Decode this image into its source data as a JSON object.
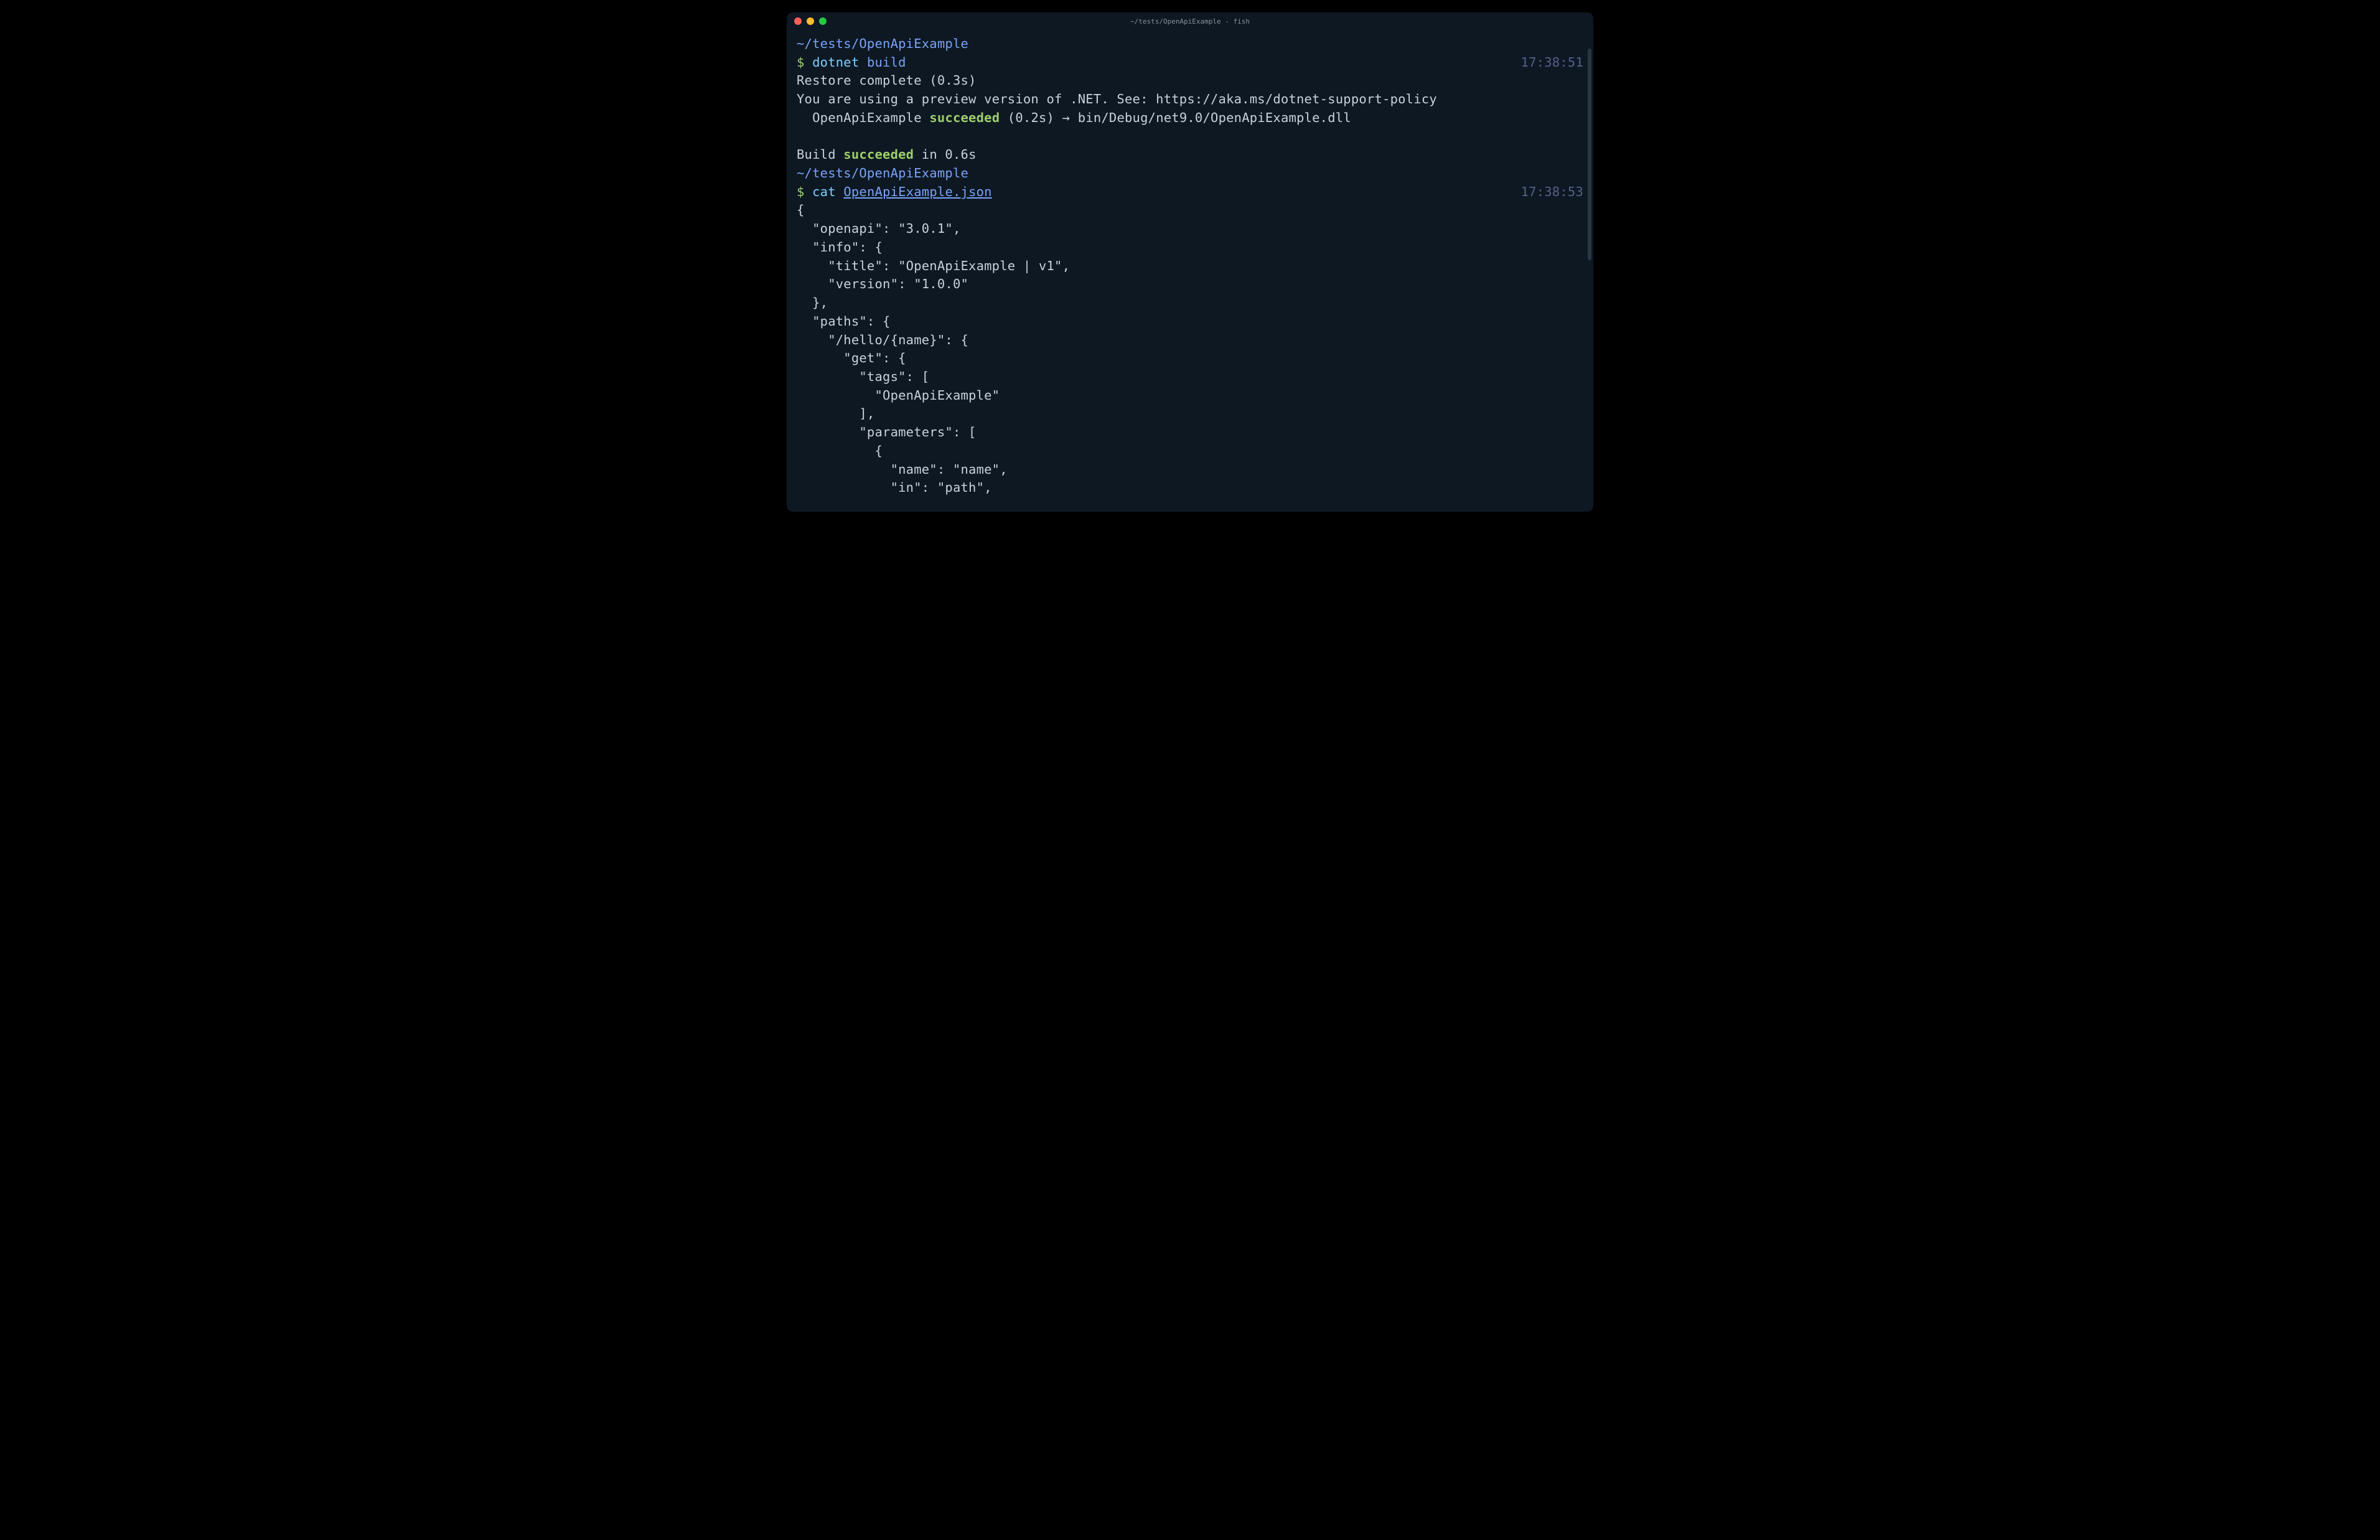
{
  "window": {
    "title": "~/tests/OpenApiExample - fish"
  },
  "colors": {
    "bg": "#0d1823",
    "cwd": "#7aa2f7",
    "cmd": "#7dcfff",
    "success": "#9ece6a",
    "time": "#565f89",
    "text": "#c9d1d9"
  },
  "cmd1": {
    "cwd": "~/tests/OpenApiExample",
    "prompt": "$ ",
    "cmd": "dotnet",
    "arg": " build",
    "time": "17:38:51",
    "out1": "Restore complete (0.3s)",
    "out2": "You are using a preview version of .NET. See: https://aka.ms/dotnet-support-policy",
    "out3a": "  OpenApiExample ",
    "out3b": "succeeded",
    "out3c": " (0.2s) → bin/Debug/net9.0/OpenApiExample.dll",
    "out4a": "Build ",
    "out4b": "succeeded",
    "out4c": " in 0.6s"
  },
  "cmd2": {
    "cwd": "~/tests/OpenApiExample",
    "prompt": "$ ",
    "cmd": "cat",
    "space": " ",
    "arg": "OpenApiExample.json",
    "time": "17:38:53",
    "json_lines": [
      "{",
      "  \"openapi\": \"3.0.1\",",
      "  \"info\": {",
      "    \"title\": \"OpenApiExample | v1\",",
      "    \"version\": \"1.0.0\"",
      "  },",
      "  \"paths\": {",
      "    \"/hello/{name}\": {",
      "      \"get\": {",
      "        \"tags\": [",
      "          \"OpenApiExample\"",
      "        ],",
      "        \"parameters\": [",
      "          {",
      "            \"name\": \"name\",",
      "            \"in\": \"path\","
    ]
  }
}
